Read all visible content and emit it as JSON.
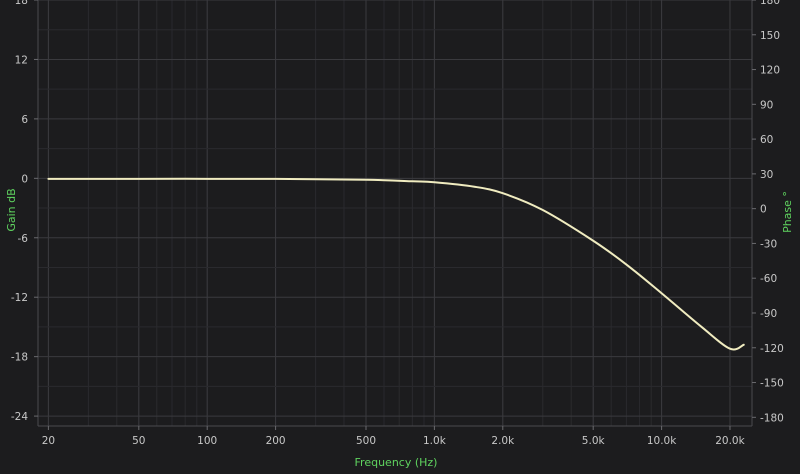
{
  "chart_data": {
    "type": "line",
    "xlabel": "Frequency (Hz)",
    "ylabel_left": "Gain dB",
    "ylabel_right": "Phase °",
    "x_scale": "log",
    "xlim": [
      18,
      25000
    ],
    "ylim_left": [
      -25,
      18
    ],
    "ylim_right": [
      -187.5,
      180
    ],
    "x_ticks": [
      {
        "value": 20,
        "label": "20"
      },
      {
        "value": 50,
        "label": "50"
      },
      {
        "value": 100,
        "label": "100"
      },
      {
        "value": 200,
        "label": "200"
      },
      {
        "value": 500,
        "label": "500"
      },
      {
        "value": 1000,
        "label": "1.0k"
      },
      {
        "value": 2000,
        "label": "2.0k"
      },
      {
        "value": 5000,
        "label": "5.0k"
      },
      {
        "value": 10000,
        "label": "10.0k"
      },
      {
        "value": 20000,
        "label": "20.0k"
      }
    ],
    "y_left_ticks": [
      {
        "value": 18,
        "label": "18"
      },
      {
        "value": 12,
        "label": "12"
      },
      {
        "value": 6,
        "label": "6"
      },
      {
        "value": 0,
        "label": "0"
      },
      {
        "value": -6,
        "label": "-6"
      },
      {
        "value": -12,
        "label": "-12"
      },
      {
        "value": -18,
        "label": "-18"
      },
      {
        "value": -24,
        "label": "-24"
      }
    ],
    "y_right_ticks": [
      {
        "value": 180,
        "label": "180"
      },
      {
        "value": 150,
        "label": "150"
      },
      {
        "value": 120,
        "label": "120"
      },
      {
        "value": 90,
        "label": "90"
      },
      {
        "value": 60,
        "label": "60"
      },
      {
        "value": 30,
        "label": "30"
      },
      {
        "value": 0,
        "label": "0"
      },
      {
        "value": -30,
        "label": "-30"
      },
      {
        "value": -60,
        "label": "-60"
      },
      {
        "value": -90,
        "label": "-90"
      },
      {
        "value": -120,
        "label": "-120"
      },
      {
        "value": -150,
        "label": "-150"
      },
      {
        "value": -180,
        "label": "-180"
      }
    ],
    "grid": true,
    "series": [
      {
        "color": "#f0ecc0",
        "x": [
          20,
          50,
          100,
          200,
          500,
          800,
          1000,
          1500,
          2000,
          3000,
          5000,
          7000,
          10000,
          15000,
          20000,
          23000
        ],
        "y": [
          -0.05,
          -0.05,
          -0.05,
          -0.06,
          -0.15,
          -0.3,
          -0.4,
          -0.85,
          -1.5,
          -3.2,
          -6.3,
          -8.7,
          -11.6,
          -15.0,
          -17.2,
          -16.8
        ]
      }
    ]
  },
  "colors": {
    "background": "#1c1c1e",
    "axis_title": "#5fd35f",
    "tick_label": "#c8c8c8",
    "curve": "#f0ecc0"
  }
}
